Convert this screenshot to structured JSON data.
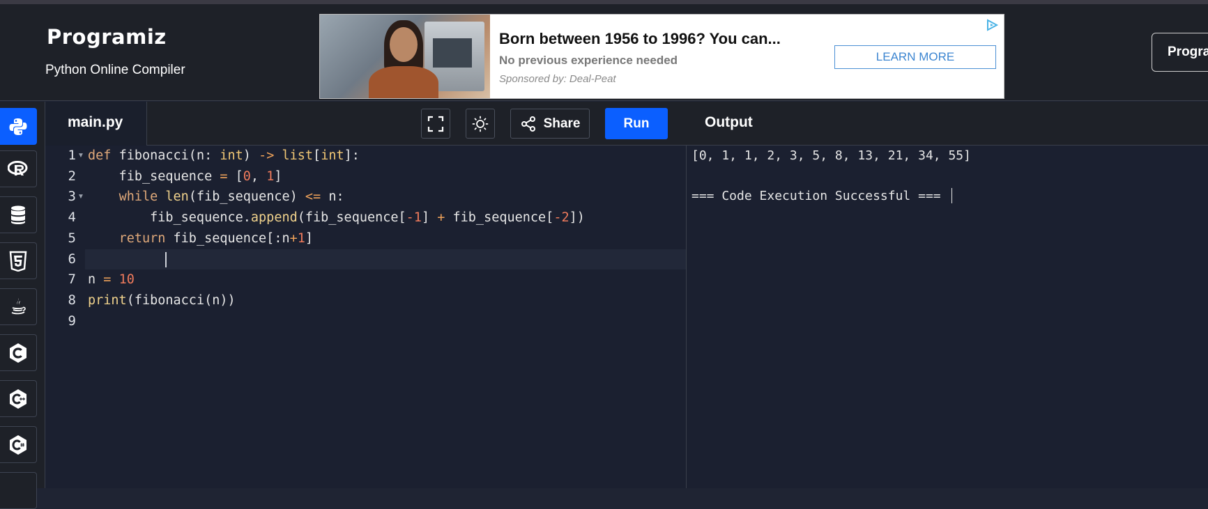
{
  "header": {
    "logo": "Programiz",
    "subtitle": "Python Online Compiler",
    "right_button": "Progra"
  },
  "ad": {
    "headline": "Born between 1956 to 1996? You can...",
    "subtext": "No previous experience needed",
    "sponsor": "Sponsored by: Deal-Peat",
    "cta": "LEARN MORE"
  },
  "sidebar": {
    "items": [
      {
        "name": "python-icon",
        "active": true
      },
      {
        "name": "r-icon",
        "active": false
      },
      {
        "name": "database-icon",
        "active": false
      },
      {
        "name": "html5-icon",
        "active": false
      },
      {
        "name": "java-icon",
        "active": false
      },
      {
        "name": "c-icon",
        "active": false
      },
      {
        "name": "cpp-icon",
        "active": false
      },
      {
        "name": "csharp-icon",
        "active": false
      }
    ]
  },
  "editor": {
    "tab": "main.py",
    "share_label": "Share",
    "run_label": "Run",
    "line_numbers": [
      "1",
      "2",
      "3",
      "4",
      "5",
      "6",
      "7",
      "8",
      "9"
    ],
    "code": [
      "def fibonacci(n: int) -> list[int]:",
      "    fib_sequence = [0, 1]",
      "    while len(fib_sequence) <= n:",
      "        fib_sequence.append(fib_sequence[-1] + fib_sequence[-2])",
      "    return fib_sequence[:n+1]",
      "",
      "n = 10",
      "print(fibonacci(n))",
      ""
    ]
  },
  "output": {
    "title": "Output",
    "lines": [
      "[0, 1, 1, 2, 3, 5, 8, 13, 21, 34, 55]",
      "",
      "=== Code Execution Successful ==="
    ]
  },
  "colors": {
    "accent": "#0b5fff",
    "background": "#1b2030",
    "header": "#1e2128"
  }
}
